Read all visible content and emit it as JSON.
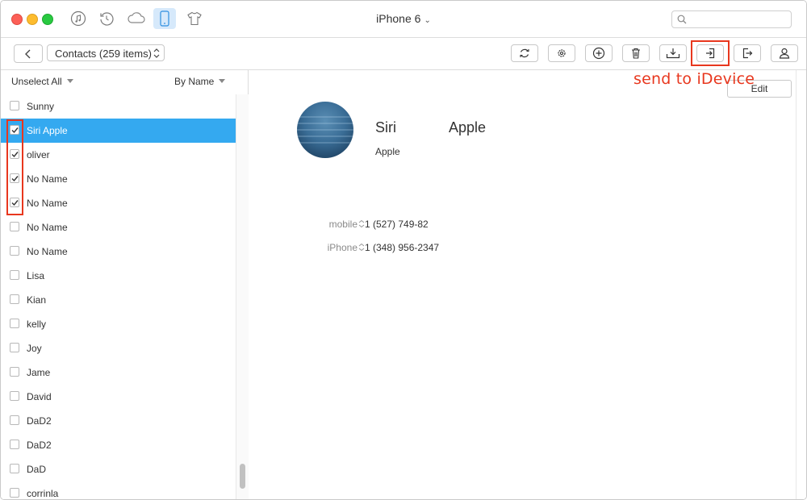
{
  "window": {
    "device_title": "iPhone 6",
    "nav_icons": [
      "music-icon",
      "restore-icon",
      "icloud-icon",
      "device-icon",
      "tshirt-icon"
    ]
  },
  "toolbar": {
    "category": "Contacts (259 items)",
    "tools": [
      "refresh-icon",
      "settings-icon",
      "add-icon",
      "delete-icon",
      "download-icon",
      "send-to-device-icon",
      "export-icon",
      "contact-icon"
    ]
  },
  "annotation": {
    "text": "send to iDevice",
    "color": "#e8371e"
  },
  "list_header": {
    "unselect": "Unselect All",
    "sort": "By Name"
  },
  "contacts": [
    {
      "name": "Sunny",
      "checked": false,
      "selected": false
    },
    {
      "name": "Siri Apple",
      "checked": true,
      "selected": true
    },
    {
      "name": "oliver",
      "checked": true,
      "selected": false
    },
    {
      "name": "No Name",
      "checked": true,
      "selected": false
    },
    {
      "name": "No Name",
      "checked": true,
      "selected": false
    },
    {
      "name": "No Name",
      "checked": false,
      "selected": false
    },
    {
      "name": "No Name",
      "checked": false,
      "selected": false
    },
    {
      "name": "Lisa",
      "checked": false,
      "selected": false
    },
    {
      "name": "Kian",
      "checked": false,
      "selected": false
    },
    {
      "name": "kelly",
      "checked": false,
      "selected": false
    },
    {
      "name": "Joy",
      "checked": false,
      "selected": false
    },
    {
      "name": "Jame",
      "checked": false,
      "selected": false
    },
    {
      "name": "David",
      "checked": false,
      "selected": false
    },
    {
      "name": "DaD2",
      "checked": false,
      "selected": false
    },
    {
      "name": "DaD2",
      "checked": false,
      "selected": false
    },
    {
      "name": "DaD",
      "checked": false,
      "selected": false
    },
    {
      "name": "corrinla",
      "checked": false,
      "selected": false
    }
  ],
  "detail": {
    "edit_label": "Edit",
    "first_name": "Siri",
    "last_name": "Apple",
    "company": "Apple",
    "phones": [
      {
        "type": "mobile",
        "number": "1 (527) 749-82"
      },
      {
        "type": "iPhone",
        "number": "1 (348) 956-2347"
      }
    ]
  },
  "colors": {
    "selected_row": "#34a9f0",
    "accent_red": "#e8371e"
  }
}
